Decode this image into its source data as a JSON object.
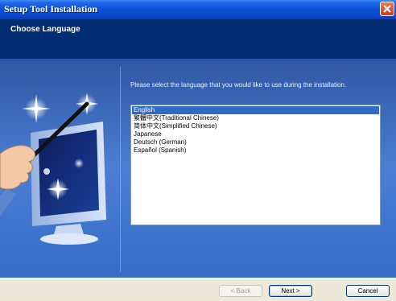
{
  "window": {
    "title": "Setup Tool Installation"
  },
  "header": {
    "title": "Choose Language"
  },
  "main": {
    "instruction": "Please select the language that you would like to use during the installation.",
    "languages": [
      {
        "label": "English",
        "selected": true
      },
      {
        "label": "繁體中文(Traditional Chinese)",
        "selected": false
      },
      {
        "label": "简体中文(Simplified Chinese)",
        "selected": false
      },
      {
        "label": "Japanese",
        "selected": false
      },
      {
        "label": "Deutsch (German)",
        "selected": false
      },
      {
        "label": "Español (Spanish)",
        "selected": false
      }
    ]
  },
  "footer": {
    "back_label": "< Back",
    "next_label": "Next >",
    "cancel_label": "Cancel"
  },
  "colors": {
    "title_bar": "#0a50d8",
    "header_bg": "#002c72",
    "selection": "#316ac5"
  }
}
